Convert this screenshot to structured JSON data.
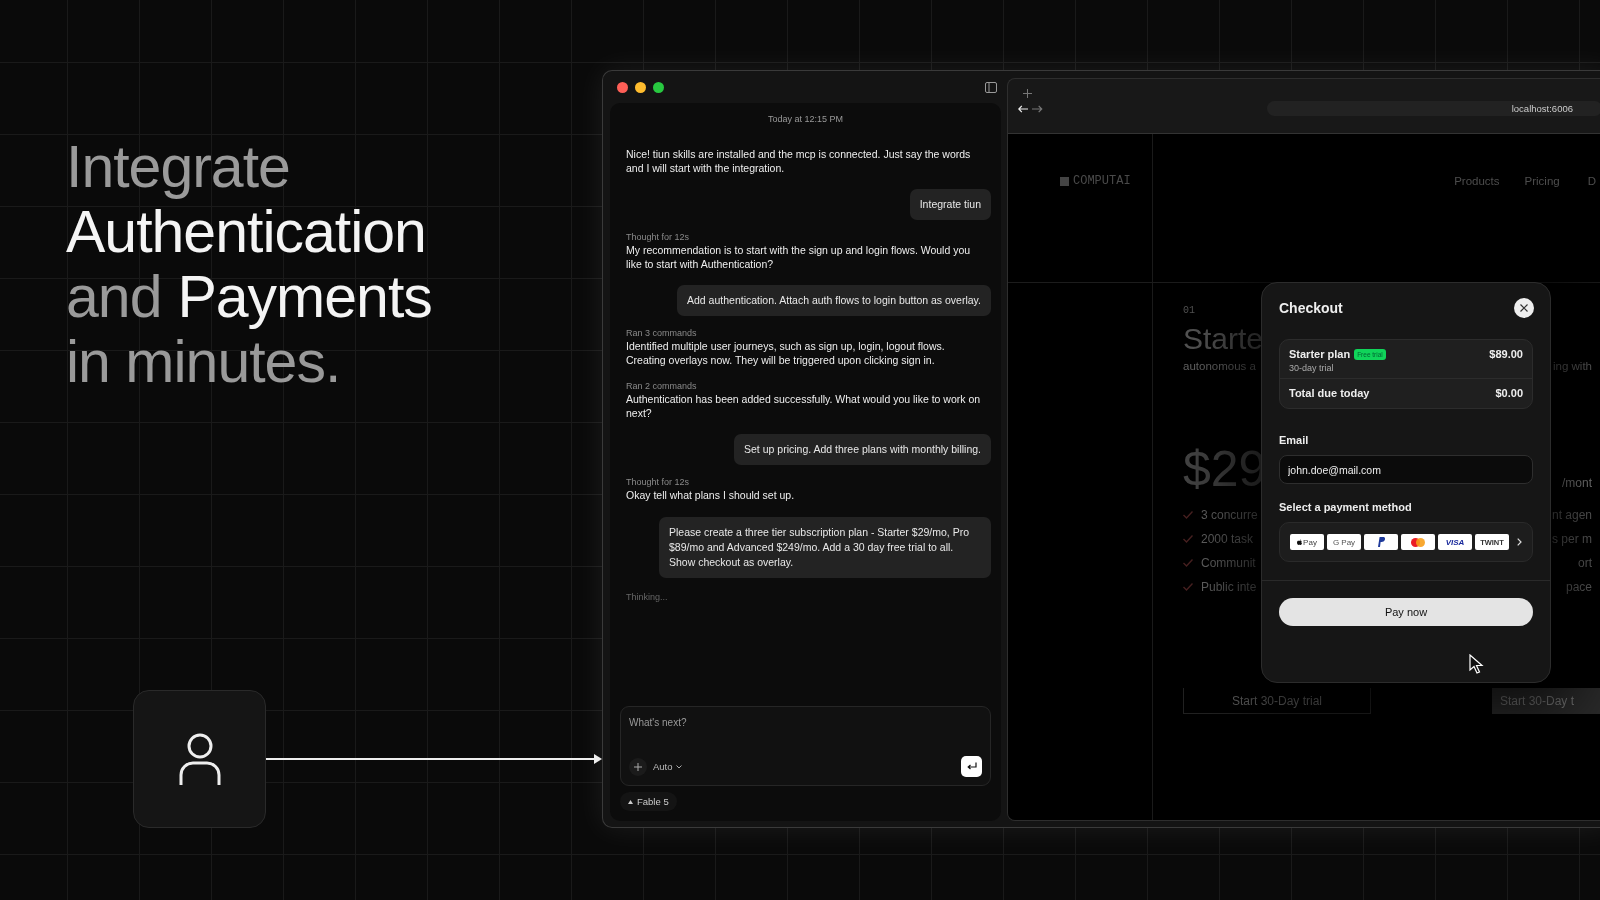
{
  "headline": {
    "lines": [
      [
        {
          "text": "Integrate",
          "highlight": false
        }
      ],
      [
        {
          "text": "Authentication",
          "highlight": true
        }
      ],
      [
        {
          "text": "and",
          "highlight": false
        },
        {
          "text": "Payments",
          "highlight": true
        }
      ],
      [
        {
          "text": "in minutes.",
          "highlight": false
        }
      ]
    ]
  },
  "chat": {
    "timestamp": "Today at 12:15 PM",
    "messages": [
      {
        "kind": "assistant",
        "text": "Nice! tiun skills are installed and the mcp is connected. Just say the words and I will start with the integration."
      },
      {
        "kind": "user",
        "text": "Integrate tiun"
      },
      {
        "kind": "assistant",
        "caption": "Thought for 12s",
        "text": "My recommendation is to start with the sign up and login flows.  Would you like to start with Authentication?"
      },
      {
        "kind": "user",
        "text": "Add authentication. Attach auth flows to login button as overlay."
      },
      {
        "kind": "assistant",
        "caption": "Ran 3 commands",
        "text": "Identified multiple user journeys, such as sign up, login, logout flows. Creating overlays now. They will be triggered upon clicking sign in."
      },
      {
        "kind": "assistant",
        "caption": "Ran 2 commands",
        "text": "Authentication has been added successfully. What would you like to work on next?"
      },
      {
        "kind": "user",
        "text": "Set up pricing. Add three plans with monthly billing."
      },
      {
        "kind": "assistant",
        "caption": "Thought for 12s",
        "text": "Okay tell what plans I should set up."
      },
      {
        "kind": "user",
        "text": "Please create a three tier subscription plan - Starter $29/mo, Pro $89/mo and Advanced $249/mo. Add a 30 day free trial to all. Show checkout as overlay."
      },
      {
        "kind": "status",
        "text": "Thinking..."
      }
    ],
    "composer": {
      "placeholder": "What's next?",
      "mode": "Auto"
    },
    "model": "Fable 5"
  },
  "browser": {
    "url": "localhost:6006",
    "site": {
      "logo": "COMPUTAI",
      "nav": [
        "Products",
        "Pricing",
        "D"
      ],
      "plan_number": "01",
      "plan_name": "Starte",
      "plan_desc": "autonomous a",
      "plan_desc_right": "ing with",
      "price": "$29",
      "period": "/mont",
      "features_left": [
        "3 concurre",
        "2000 task",
        "Communit",
        "Public inte"
      ],
      "features_right": [
        "nt agen",
        "s per m",
        "ort",
        "pace"
      ],
      "buttons": [
        "Start 30-Day trial",
        "Start 30-Day t"
      ]
    }
  },
  "checkout": {
    "title": "Checkout",
    "plan": "Starter plan",
    "badge": "Free trial",
    "plan_price": "$89.00",
    "plan_note": "30-day trial",
    "total_label": "Total due today",
    "total": "$0.00",
    "email_label": "Email",
    "email": "john.doe@mail.com",
    "payment_label": "Select a payment method",
    "methods": [
      {
        "kind": "applepay",
        "label": "Pay"
      },
      {
        "kind": "googlepay",
        "label": "G Pay"
      },
      {
        "kind": "paypal"
      },
      {
        "kind": "mastercard"
      },
      {
        "kind": "visa",
        "label": "VISA"
      },
      {
        "kind": "twint",
        "label": "TWINT"
      }
    ],
    "pay_button": "Pay now"
  }
}
